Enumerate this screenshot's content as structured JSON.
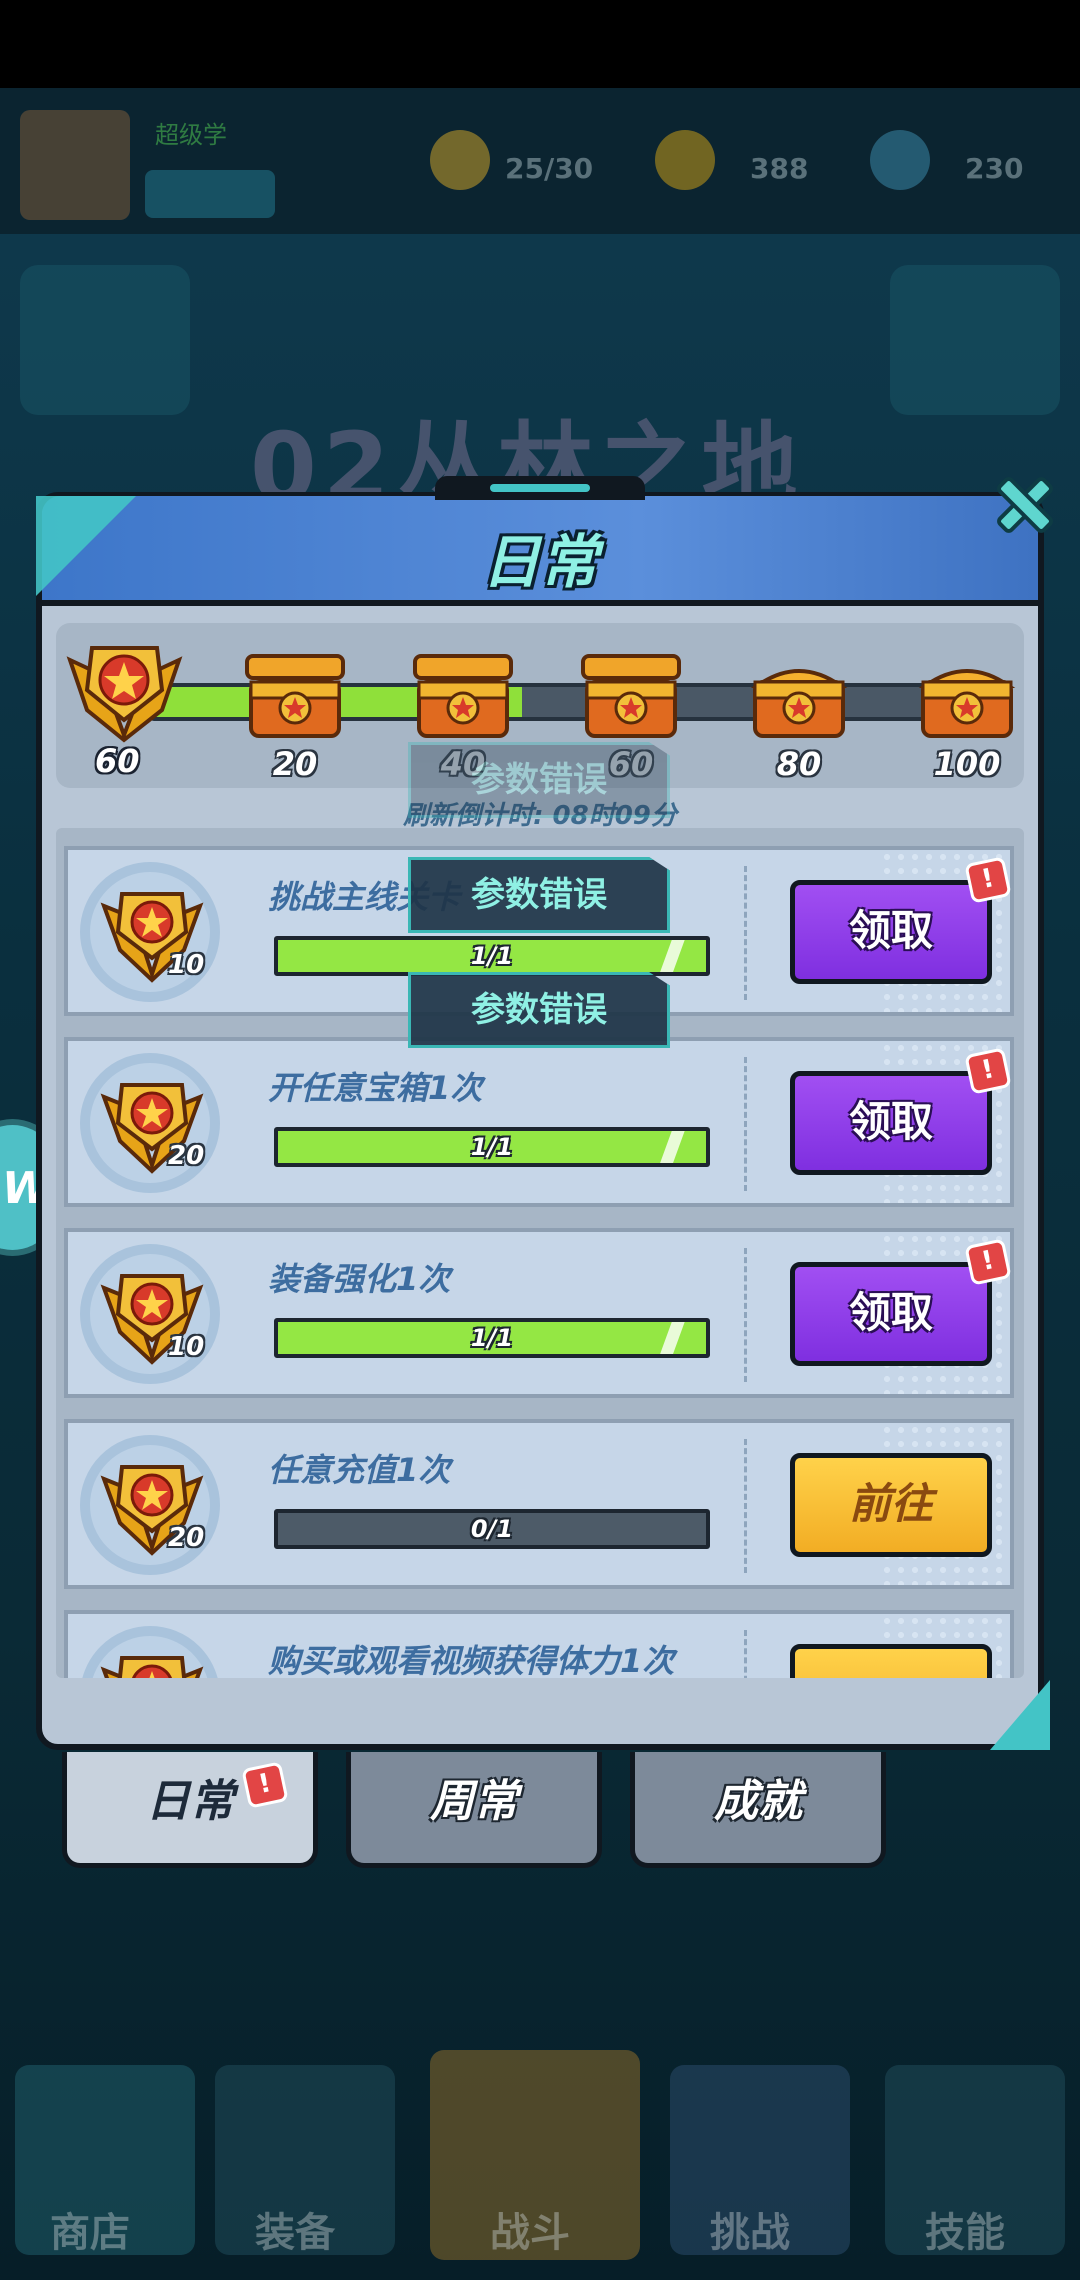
{
  "background": {
    "player_name": "超级学",
    "stamina": "25/30",
    "coins": "388",
    "gems": "230",
    "event_title": "02丛林之地",
    "nav": [
      "商店",
      "装备",
      "战斗",
      "挑战",
      "技能"
    ]
  },
  "panel": {
    "title": "日常",
    "close_icon": "close-x-icon"
  },
  "progress": {
    "current_points": "60",
    "max_points": 100,
    "milestones": [
      "20",
      "40",
      "60",
      "80",
      "100"
    ],
    "reached": [
      true,
      true,
      true,
      false,
      false
    ],
    "refresh_timer": "刷新倒计时: 08时09分"
  },
  "tasks": [
    {
      "name": "挑战主线关卡",
      "points": "10",
      "progress": "1/1",
      "ratio": 1,
      "button": "领取",
      "type": "claim",
      "alert": "!"
    },
    {
      "name": "开任意宝箱1次",
      "points": "20",
      "progress": "1/1",
      "ratio": 1,
      "button": "领取",
      "type": "claim",
      "alert": "!"
    },
    {
      "name": "装备强化1次",
      "points": "10",
      "progress": "1/1",
      "ratio": 1,
      "button": "领取",
      "type": "claim",
      "alert": "!"
    },
    {
      "name": "任意充值1次",
      "points": "20",
      "progress": "0/1",
      "ratio": 0,
      "button": "前往",
      "type": "go",
      "alert": ""
    },
    {
      "name": "购买或观看视频获得体力1次",
      "points": "",
      "progress": "",
      "ratio": 0,
      "button": "",
      "type": "go",
      "alert": ""
    }
  ],
  "toasts": [
    "参数错误",
    "参数错误",
    "参数错误"
  ],
  "tabs": {
    "daily": "日常",
    "weekly": "周常",
    "achievement": "成就",
    "daily_alert": "!"
  },
  "colors": {
    "accent_cyan": "#43c4c6",
    "claim_purple": "#8b3be8",
    "go_yellow": "#f7bd31",
    "progress_green": "#8fe03a"
  }
}
